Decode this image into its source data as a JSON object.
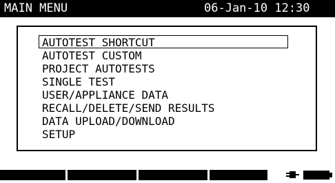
{
  "header": {
    "title": "MAIN MENU",
    "datetime": "06-Jan-10 12:30"
  },
  "menu": {
    "items": [
      {
        "label": "AUTOTEST SHORTCUT",
        "selected": true
      },
      {
        "label": "AUTOTEST CUSTOM",
        "selected": false
      },
      {
        "label": "PROJECT AUTOTESTS",
        "selected": false
      },
      {
        "label": "SINGLE TEST",
        "selected": false
      },
      {
        "label": "USER/APPLIANCE DATA",
        "selected": false
      },
      {
        "label": "RECALL/DELETE/SEND RESULTS",
        "selected": false
      },
      {
        "label": "DATA UPLOAD/DOWNLOAD",
        "selected": false
      },
      {
        "label": "SETUP",
        "selected": false
      }
    ]
  },
  "status": {
    "icons": [
      "mains-plug-icon",
      "battery-icon"
    ]
  }
}
